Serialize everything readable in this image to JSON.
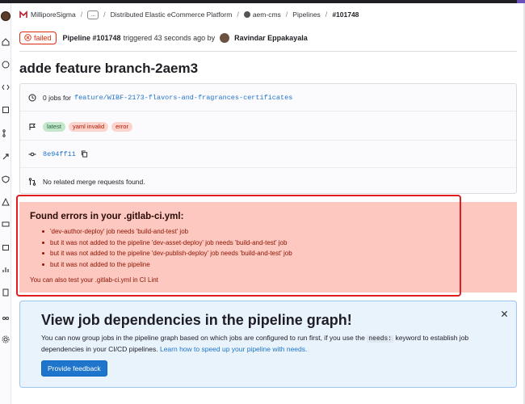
{
  "colors": {
    "accent": "#1f75cb",
    "danger": "#dd2b0e",
    "error_bg": "#fcc8c0",
    "highlight": "#e11d24",
    "banner_bg": "#e9f3fc"
  },
  "breadcrumb": {
    "items": [
      "MilliporeSigma",
      "...",
      "Distributed Elastic eCommerce Platform",
      "aem-cms",
      "Pipelines",
      "#101748"
    ]
  },
  "header": {
    "status": "failed",
    "pipeline_label": "Pipeline #101748",
    "triggered_text": "triggered 43 seconds ago by",
    "user": "Ravindar Eppakayala"
  },
  "page_title": "adde feature branch-2aem3",
  "info": {
    "jobs_prefix": "0 jobs for",
    "branch": "feature/WIBF-2173-flavors-and-fragrances-certificates",
    "badges": [
      "latest",
      "yaml invalid",
      "error"
    ],
    "sha": "8e94ff11",
    "merge_requests": "No related merge requests found."
  },
  "errors": {
    "title": "Found errors in your .gitlab-ci.yml:",
    "items": [
      "'dev-author-deploy' job needs 'build-and-test' job",
      "but it was not added to the pipeline 'dev-asset-deploy' job needs 'build-and-test' job",
      "but it was not added to the pipeline 'dev-publish-deploy' job needs 'build-and-test' job",
      "but it was not added to the pipeline"
    ],
    "footer": "You can also test your .gitlab-ci.yml in CI Lint"
  },
  "banner": {
    "title": "View job dependencies in the pipeline graph!",
    "text_before": "You can now group jobs in the pipeline graph based on which jobs are configured to run first, if you use the",
    "keyword": "needs:",
    "text_after": "keyword to establish job dependencies in your CI/CD pipelines.",
    "link": "Learn how to speed up your pipeline with needs.",
    "button": "Provide feedback"
  },
  "icons": {
    "status": "x-circle-icon",
    "jobs": "clock-icon",
    "flag": "flag-icon",
    "commit": "commit-icon",
    "copy": "copy-icon",
    "merge": "merge-request-icon",
    "close": "close-icon"
  }
}
